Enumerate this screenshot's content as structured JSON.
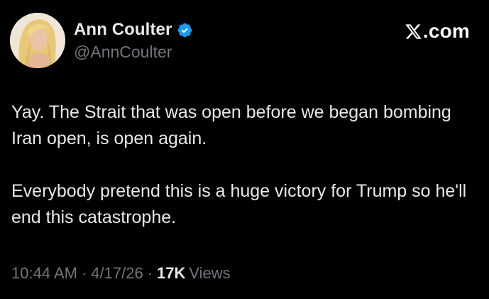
{
  "author": {
    "display_name": "Ann Coulter",
    "handle": "@AnnCoulter",
    "verified": true,
    "verified_icon": "verified-badge-icon"
  },
  "brand": {
    "icon": "x-logo-icon",
    "text": ".com"
  },
  "tweet": {
    "paragraphs": [
      "Yay. The Strait that was open before we began bombing Iran open, is open again.",
      "Everybody pretend this is a huge victory for Trump so he'll end this catastrophe."
    ]
  },
  "meta": {
    "time": "10:44 AM",
    "separator": "·",
    "date": "4/17/26",
    "views_count": "17K",
    "views_label": "Views"
  },
  "colors": {
    "background": "#000000",
    "text_primary": "#e7e9ea",
    "text_secondary": "#71767b",
    "verified_blue": "#1d9bf0"
  }
}
